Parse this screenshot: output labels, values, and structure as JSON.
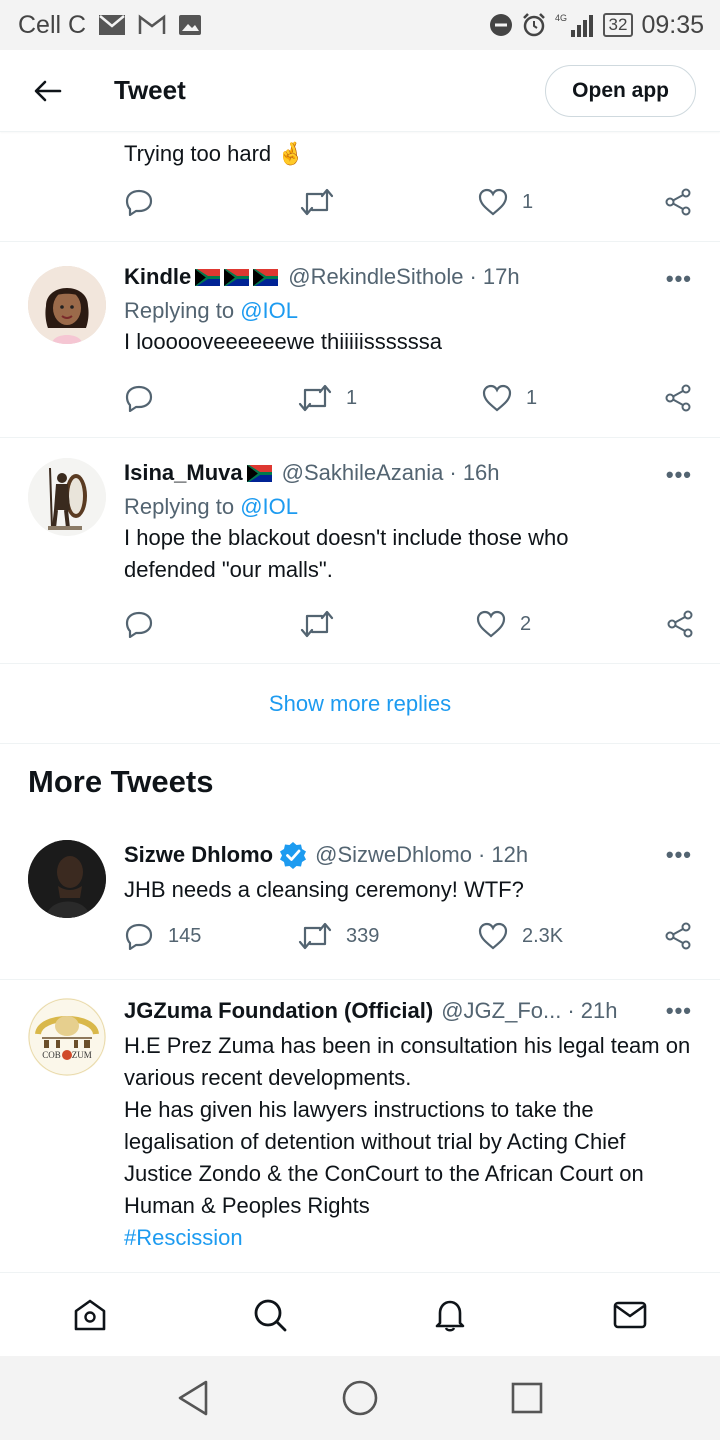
{
  "status_bar": {
    "carrier": "Cell C",
    "network": "4G",
    "battery": "32",
    "time": "09:35"
  },
  "header": {
    "title": "Tweet",
    "open_app_label": "Open app"
  },
  "tweets": [
    {
      "text": "Trying too hard 🤞",
      "replies": "",
      "retweets": "",
      "likes": "1"
    },
    {
      "name": "Kindle",
      "handle": "@RekindleSithole",
      "time": "· 17h",
      "replying_label": "Replying to",
      "replying_to": "@IOL",
      "text": "I loooooveeeeeewe thiiiiissssssa",
      "replies": "",
      "retweets": "1",
      "likes": "1"
    },
    {
      "name": "Isina_Muva",
      "handle": "@SakhileAzania",
      "time": "· 16h",
      "replying_label": "Replying to",
      "replying_to": "@IOL",
      "text": "I hope the blackout doesn't include those who defended \"our malls\".",
      "replies": "",
      "retweets": "",
      "likes": "2"
    }
  ],
  "show_more_replies": "Show more replies",
  "more_tweets_heading": "More Tweets",
  "more_tweets": [
    {
      "name": "Sizwe Dhlomo",
      "handle": "@SizweDhlomo",
      "time": "· 12h",
      "text": "JHB needs a cleansing ceremony! WTF?",
      "replies": "145",
      "retweets": "339",
      "likes": "2.3K"
    },
    {
      "name": "JGZuma Foundation (Official)",
      "handle": "@JGZ_Fo...",
      "time": "· 21h",
      "text_lines": [
        "H.E Prez Zuma has been in consultation his legal team on various recent developments.",
        "He has given his lawyers instructions to take the legalisation of detention without trial by Acting Chief Justice Zondo & the ConCourt to the African Court on Human & Peoples Rights"
      ],
      "hashtag": "#Rescission",
      "logo_text": "COB G ZUM"
    }
  ],
  "more_label": "•••",
  "colors": {
    "accent": "#1d9bf0",
    "secondary_text": "#536471",
    "verified": "#1d9bf0"
  },
  "tab_bar": [
    "home-icon",
    "search-icon",
    "notifications-icon",
    "messages-icon"
  ],
  "nav_bar": [
    "back-triangle",
    "home-circle",
    "recents-square"
  ]
}
